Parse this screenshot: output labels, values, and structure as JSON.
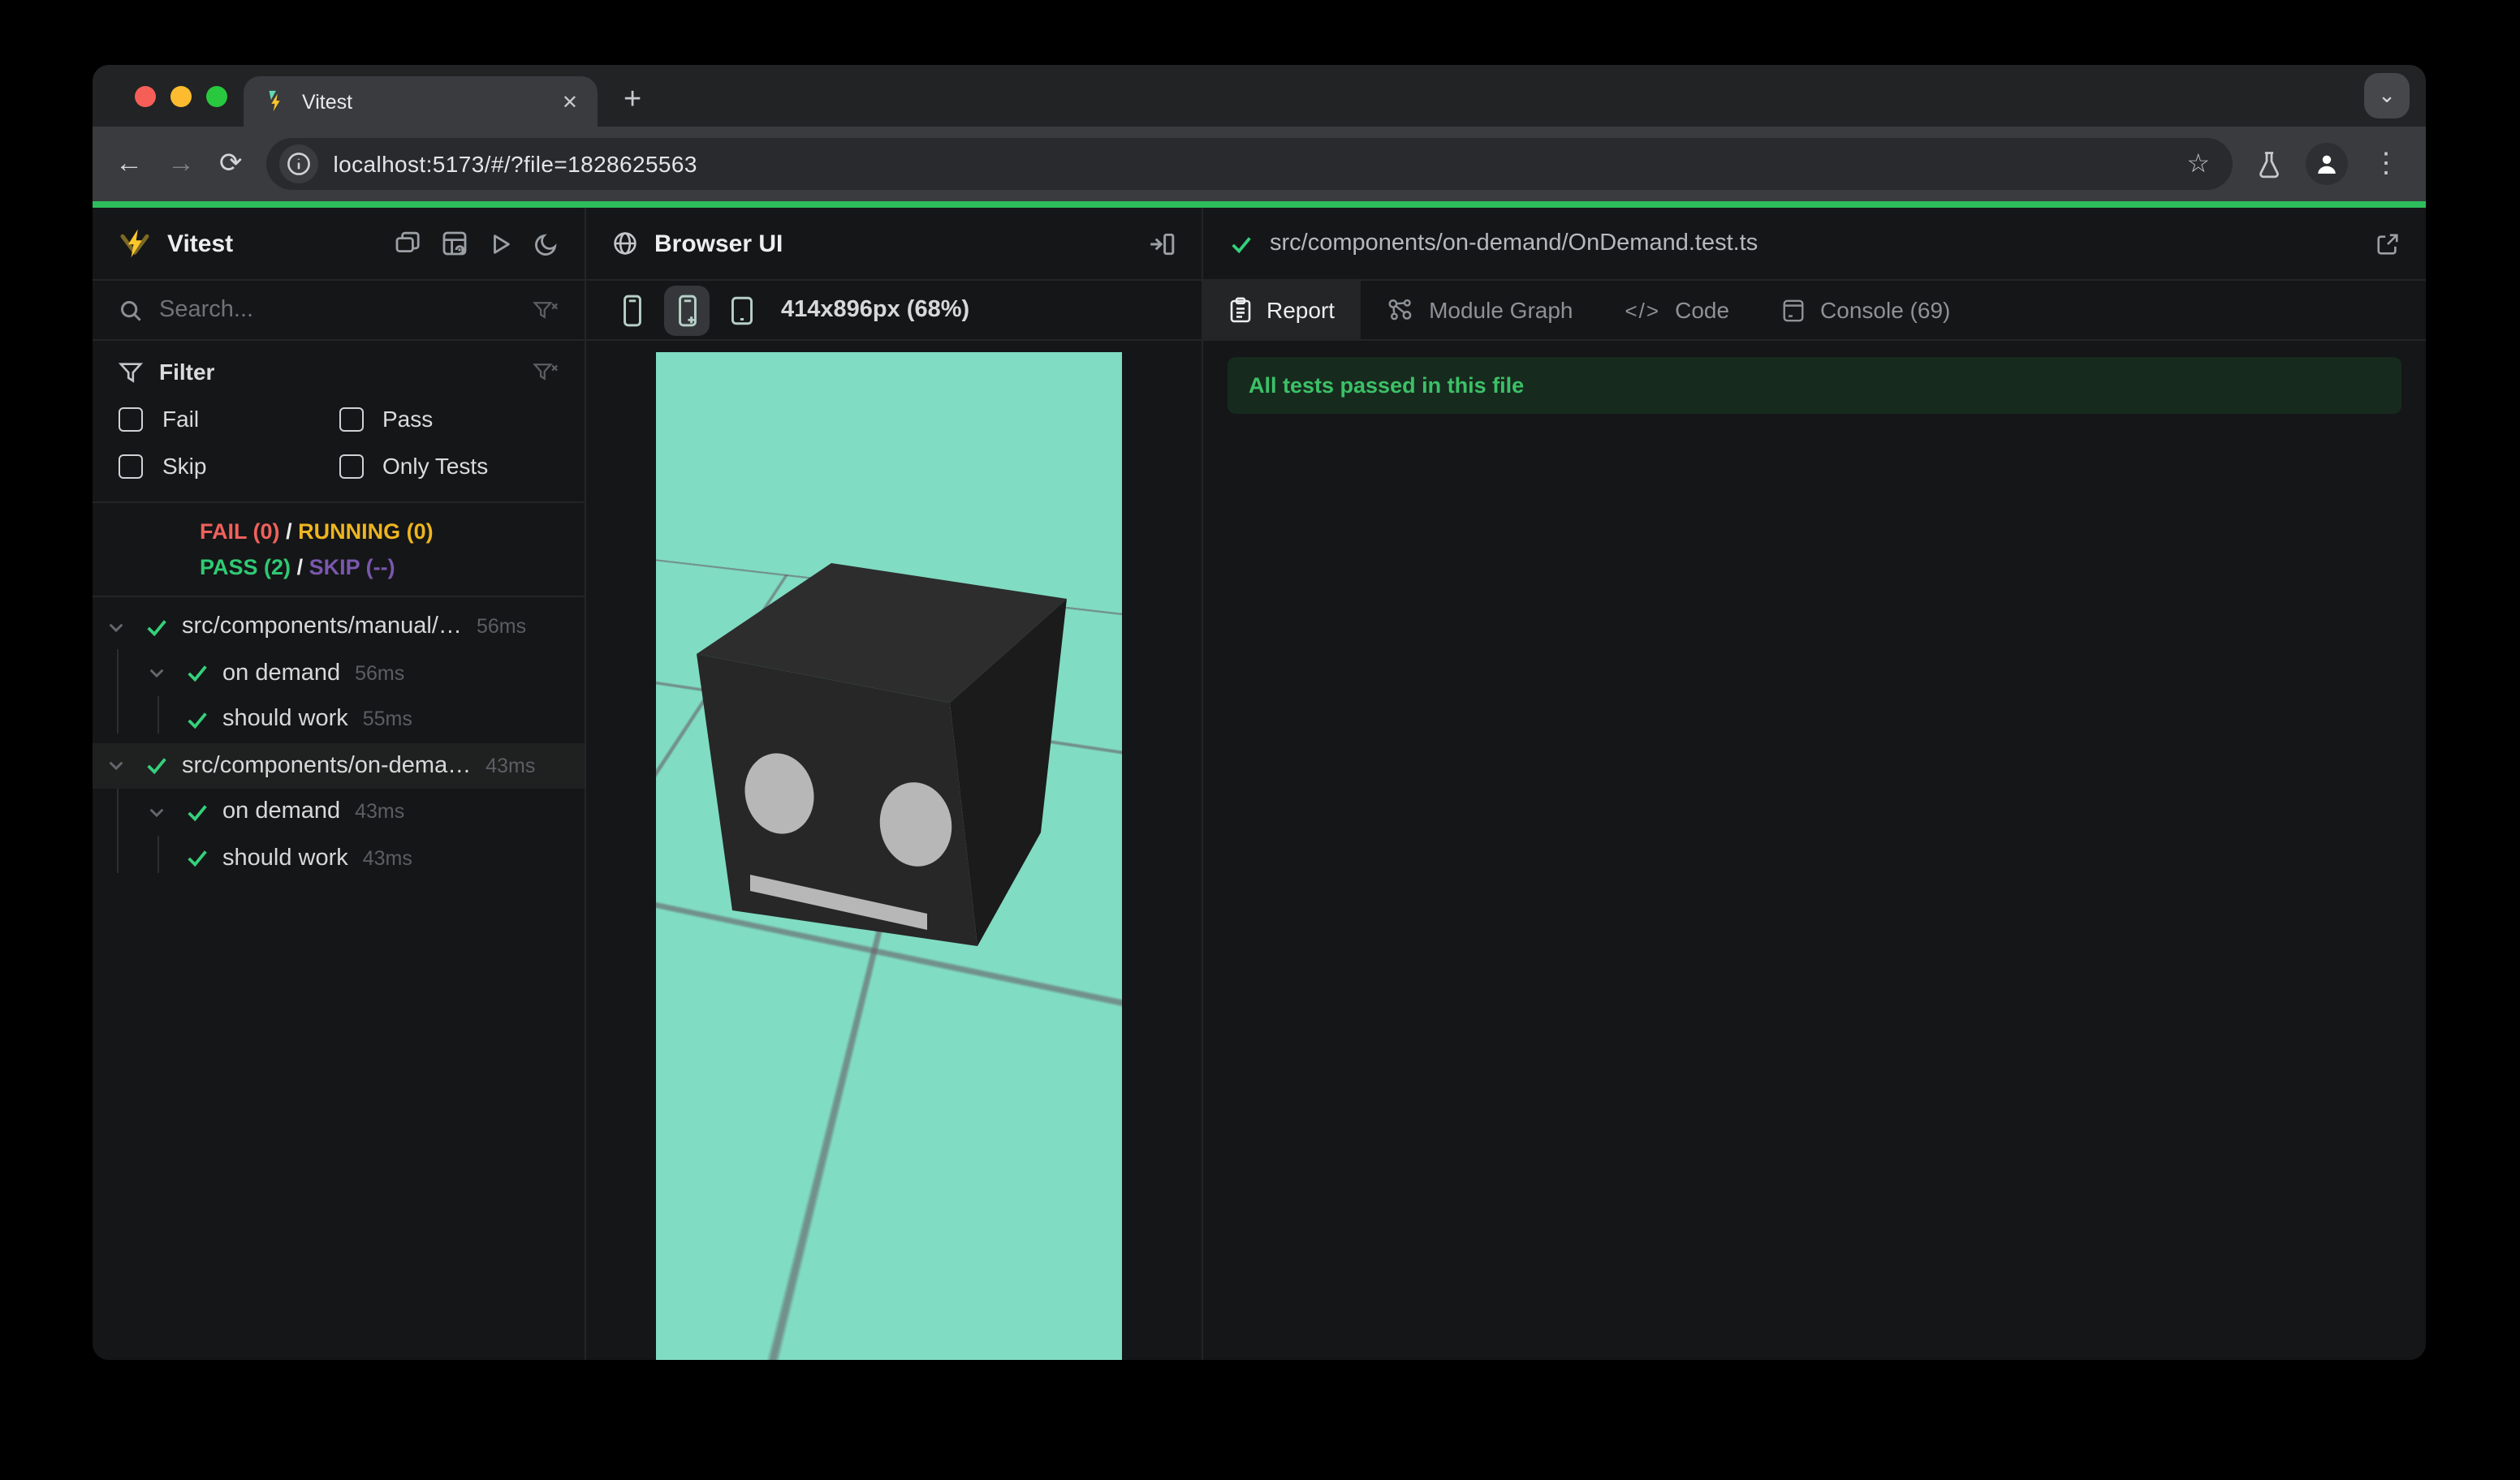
{
  "browser_chrome": {
    "tab_title": "Vitest",
    "url": "localhost:5173/#/?file=1828625563",
    "icons": {
      "close": "✕",
      "new_tab": "+",
      "back": "←",
      "forward": "→",
      "reload": "⟳",
      "more": "⋮",
      "bookmark": "☆",
      "tab_search": "⌄",
      "code_tab": "</>"
    }
  },
  "vitest_sidebar": {
    "title": "Vitest",
    "search_placeholder": "Search...",
    "filter": {
      "heading": "Filter",
      "options": [
        "Fail",
        "Pass",
        "Skip",
        "Only Tests"
      ]
    },
    "status": {
      "fail_label": "FAIL (0)",
      "running_label": "RUNNING (0)",
      "pass_label": "PASS (2)",
      "skip_label": "SKIP (--)",
      "separator": "/"
    },
    "tree": [
      {
        "label": "src/components/manual/…",
        "duration": "56ms"
      },
      {
        "label": "on demand",
        "duration": "56ms"
      },
      {
        "label": "should work",
        "duration": "55ms"
      },
      {
        "label": "src/components/on-dema…",
        "duration": "43ms"
      },
      {
        "label": "on demand",
        "duration": "43ms"
      },
      {
        "label": "should work",
        "duration": "43ms"
      }
    ]
  },
  "browser_ui_panel": {
    "title": "Browser UI",
    "viewport_size_label": "414x896px (68%)"
  },
  "report_panel": {
    "file_path": "src/components/on-demand/OnDemand.test.ts",
    "tabs": [
      "Report",
      "Module Graph",
      "Code",
      "Console (69)"
    ],
    "active_tab": "Report",
    "banner_text": "All tests passed in this file"
  },
  "colors": {
    "accent_green_line": "#2ebd5c",
    "pass_green": "#2fca74",
    "fail_red": "#f0615c",
    "running_yellow": "#edb51f",
    "skip_purple": "#7a57ad",
    "viewport_teal": "#80dcc2"
  }
}
